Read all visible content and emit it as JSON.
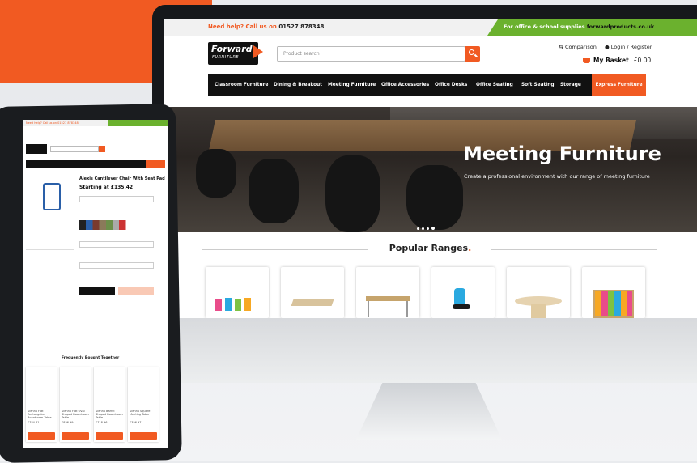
{
  "topbar": {
    "help_prefix": "Need help? Call us on",
    "phone": "01527 878348",
    "supplies_prefix": "For office & school supplies",
    "supplies_site": "forwardproducts.co.uk"
  },
  "logo": {
    "line1": "Forward",
    "line2": "FURNITURE"
  },
  "search": {
    "placeholder": "Product search"
  },
  "account": {
    "comparison": "Comparison",
    "login": "Login / Register",
    "basket_label": "My Basket",
    "basket_amount": "£0.00"
  },
  "nav": {
    "items": [
      "Classroom Furniture",
      "Dining & Breakout",
      "Meeting Furniture",
      "Office Accessories",
      "Office Desks",
      "Office Seating",
      "Soft Seating",
      "Storage"
    ],
    "express": "Express Furniture"
  },
  "hero": {
    "title": "Meeting Furniture",
    "subtitle": "Create a professional environment with our range of meeting furniture"
  },
  "popular": {
    "title": "Popular Ranges",
    "dot": "."
  },
  "tablet": {
    "help": "Need help? Call us on 01527 878348",
    "product_title": "Alexis Cantilever Chair With Seat Pad",
    "price": "Starting at £135.42",
    "frequently": "Frequently Bought Together",
    "products": [
      {
        "name": "Sienna Flat Rectangular Boardroom Table",
        "price": "£784.81"
      },
      {
        "name": "Sienna Flat Oval Shaped Boardroom Table",
        "price": "£836.99"
      },
      {
        "name": "Sienna Barrel Shaped Boardroom Table",
        "price": "£718.96"
      },
      {
        "name": "Sienna Square Meeting Table",
        "price": "£356.97"
      }
    ]
  },
  "colors": {
    "brand": "#f15a22",
    "green": "#6bb12e"
  }
}
